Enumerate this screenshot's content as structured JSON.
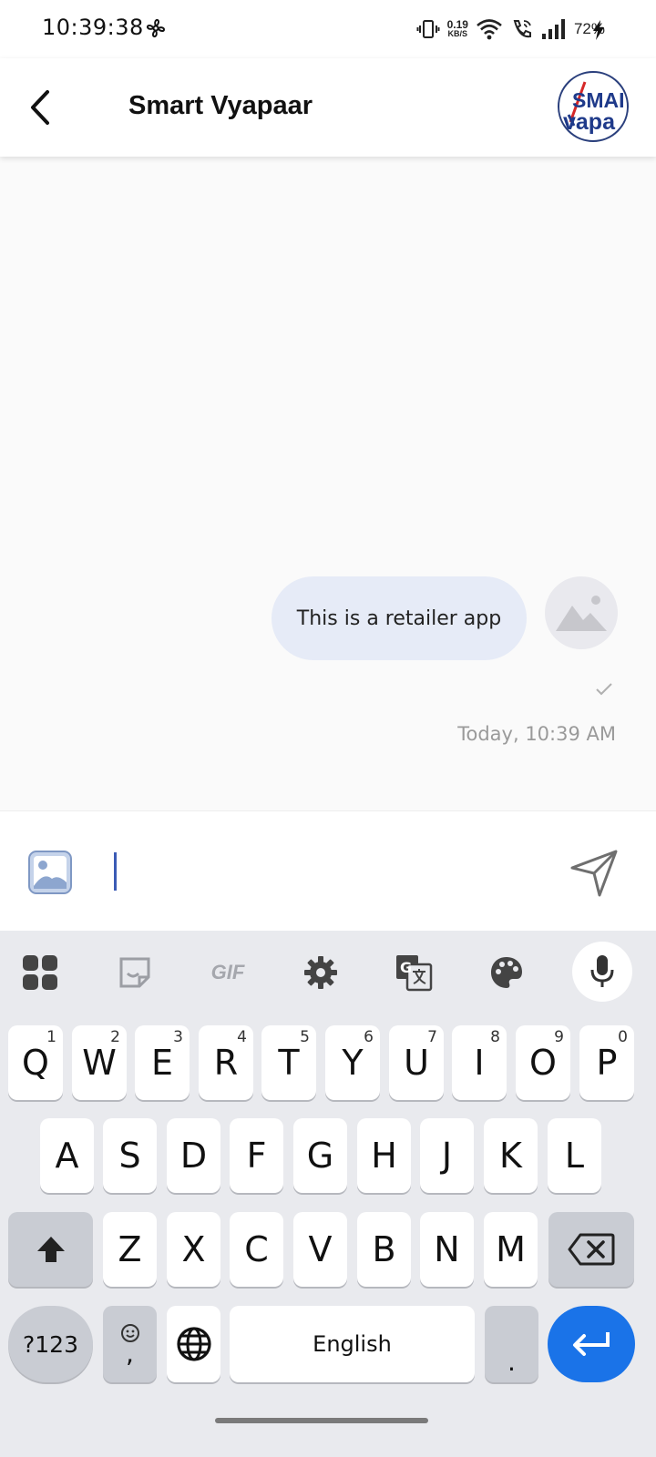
{
  "status_bar": {
    "time": "10:39:38",
    "net_speed_value": "0.19",
    "net_speed_unit": "KB/S",
    "battery": "72%"
  },
  "app_bar": {
    "title": "Smart Vyapaar",
    "logo_text_line1": "SMAI",
    "logo_text_line2": "vapa"
  },
  "chat": {
    "messages": [
      {
        "text": "This is a retailer app",
        "timestamp": "Today, 10:39 AM",
        "status": "sent"
      }
    ]
  },
  "composer": {
    "value": "",
    "placeholder": ""
  },
  "keyboard": {
    "toolbar": [
      "apps-icon",
      "sticker-icon",
      "gif-icon",
      "settings-icon",
      "translate-icon",
      "palette-icon",
      "mic-icon"
    ],
    "gif_label": "GIF",
    "row1": [
      {
        "label": "Q",
        "hint": "1"
      },
      {
        "label": "W",
        "hint": "2"
      },
      {
        "label": "E",
        "hint": "3"
      },
      {
        "label": "R",
        "hint": "4"
      },
      {
        "label": "T",
        "hint": "5"
      },
      {
        "label": "Y",
        "hint": "6"
      },
      {
        "label": "U",
        "hint": "7"
      },
      {
        "label": "I",
        "hint": "8"
      },
      {
        "label": "O",
        "hint": "9"
      },
      {
        "label": "P",
        "hint": "0"
      }
    ],
    "row2": [
      "A",
      "S",
      "D",
      "F",
      "G",
      "H",
      "J",
      "K",
      "L"
    ],
    "row3": [
      "Z",
      "X",
      "C",
      "V",
      "B",
      "N",
      "M"
    ],
    "symbols_label": "?123",
    "comma_label": ",",
    "space_label": "English",
    "period_label": "."
  },
  "colors": {
    "accent": "#1a73e8",
    "bubble": "#e6ebf7",
    "logo_blue": "#1f3a8a"
  }
}
